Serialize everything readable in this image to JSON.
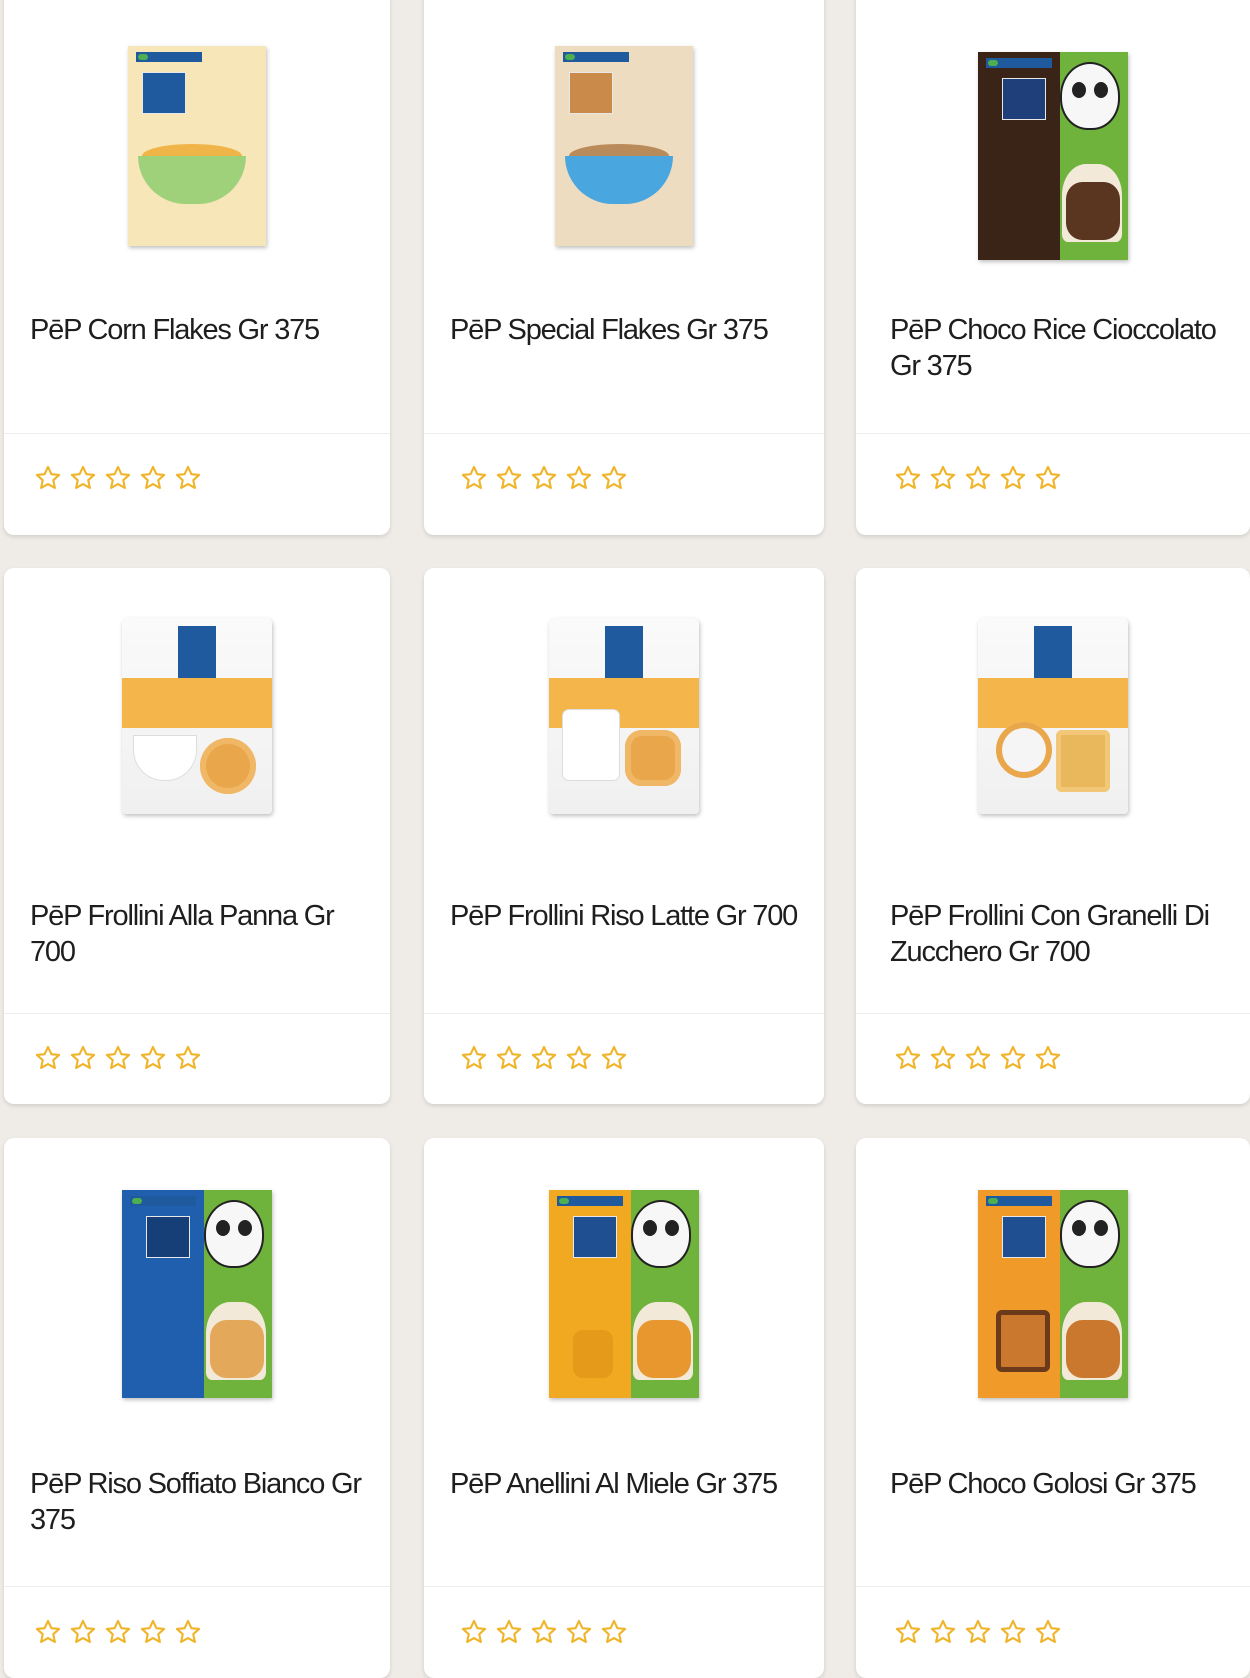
{
  "colors": {
    "page_background": "#efebe6",
    "card_background": "#ffffff",
    "star_outline": "#f0b429",
    "text": "#1e1e1e"
  },
  "products": [
    {
      "name": "PēP Corn Flakes Gr 375",
      "image": "corn-flakes-box",
      "rating": 0,
      "max_rating": 5
    },
    {
      "name": "PēP Special Flakes Gr 375",
      "image": "special-flakes-box",
      "rating": 0,
      "max_rating": 5
    },
    {
      "name": "PēP Choco Rice Cioccolato Gr 375",
      "image": "choco-rice-box",
      "rating": 0,
      "max_rating": 5
    },
    {
      "name": "PēP Frollini Alla Panna Gr 700",
      "image": "frollini-panna-bag",
      "rating": 0,
      "max_rating": 5
    },
    {
      "name": "PēP Frollini Riso Latte Gr 700",
      "image": "frollini-riso-latte-bag",
      "rating": 0,
      "max_rating": 5
    },
    {
      "name": "PēP Frollini Con Granelli Di Zucchero Gr 700",
      "image": "frollini-zucchero-bag",
      "rating": 0,
      "max_rating": 5
    },
    {
      "name": "PēP Riso Soffiato Bianco Gr 375",
      "image": "riso-soffiato-box",
      "rating": 0,
      "max_rating": 5
    },
    {
      "name": "PēP Anellini Al Miele Gr 375",
      "image": "anellini-miele-box",
      "rating": 0,
      "max_rating": 5
    },
    {
      "name": "PēP Choco Golosi Gr 375",
      "image": "choco-golosi-box",
      "rating": 0,
      "max_rating": 5
    }
  ]
}
